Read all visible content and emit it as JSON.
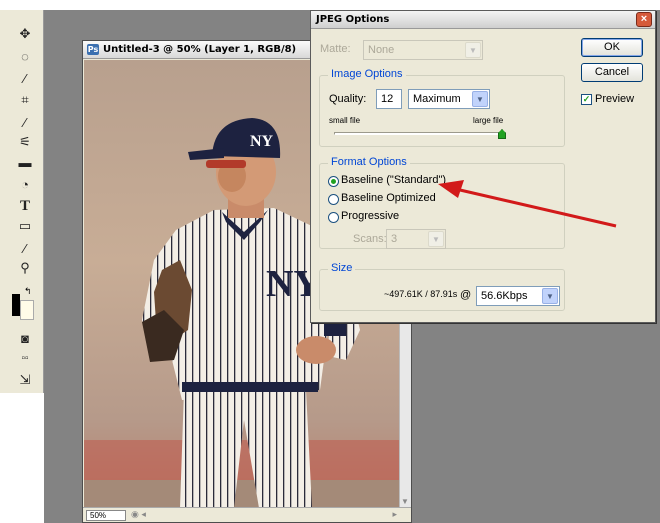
{
  "document": {
    "title": "Untitled-3 @ 50% (Layer 1, RGB/8)",
    "zoom": "50%"
  },
  "dialog": {
    "title": "JPEG Options",
    "matte_label": "Matte:",
    "matte_value": "None",
    "image_options": {
      "legend": "Image Options",
      "quality_label": "Quality:",
      "quality_value": "12",
      "quality_preset": "Maximum",
      "small_file_label": "small file",
      "large_file_label": "large file",
      "slider_level": 1.0
    },
    "format_options": {
      "legend": "Format Options",
      "options": [
        {
          "label": "Baseline (\"Standard\")",
          "selected": true
        },
        {
          "label": "Baseline Optimized",
          "selected": false
        },
        {
          "label": "Progressive",
          "selected": false
        }
      ],
      "scans_label": "Scans:",
      "scans_value": "3"
    },
    "size": {
      "legend": "Size",
      "estimate": "~497.61K / 87.91s",
      "at": "@",
      "speed": "56.6Kbps"
    },
    "buttons": {
      "ok": "OK",
      "cancel": "Cancel"
    },
    "preview": {
      "label": "Preview",
      "checked": true
    }
  },
  "annotation": {
    "arrow_color": "#d21a1a"
  },
  "colors": {
    "workspace": "#838383",
    "legend_blue": "#0046d5",
    "accent_green": "#21a121"
  },
  "icons": [
    "move-icon",
    "lasso-icon",
    "magic-wand-icon",
    "crop-icon",
    "brush-icon",
    "history-brush-icon",
    "eraser-icon",
    "blur-icon",
    "type-icon",
    "shape-icon",
    "eyedropper-icon",
    "zoom-icon",
    "mask-icon",
    "screen-mode-icon",
    "jump-icon"
  ]
}
